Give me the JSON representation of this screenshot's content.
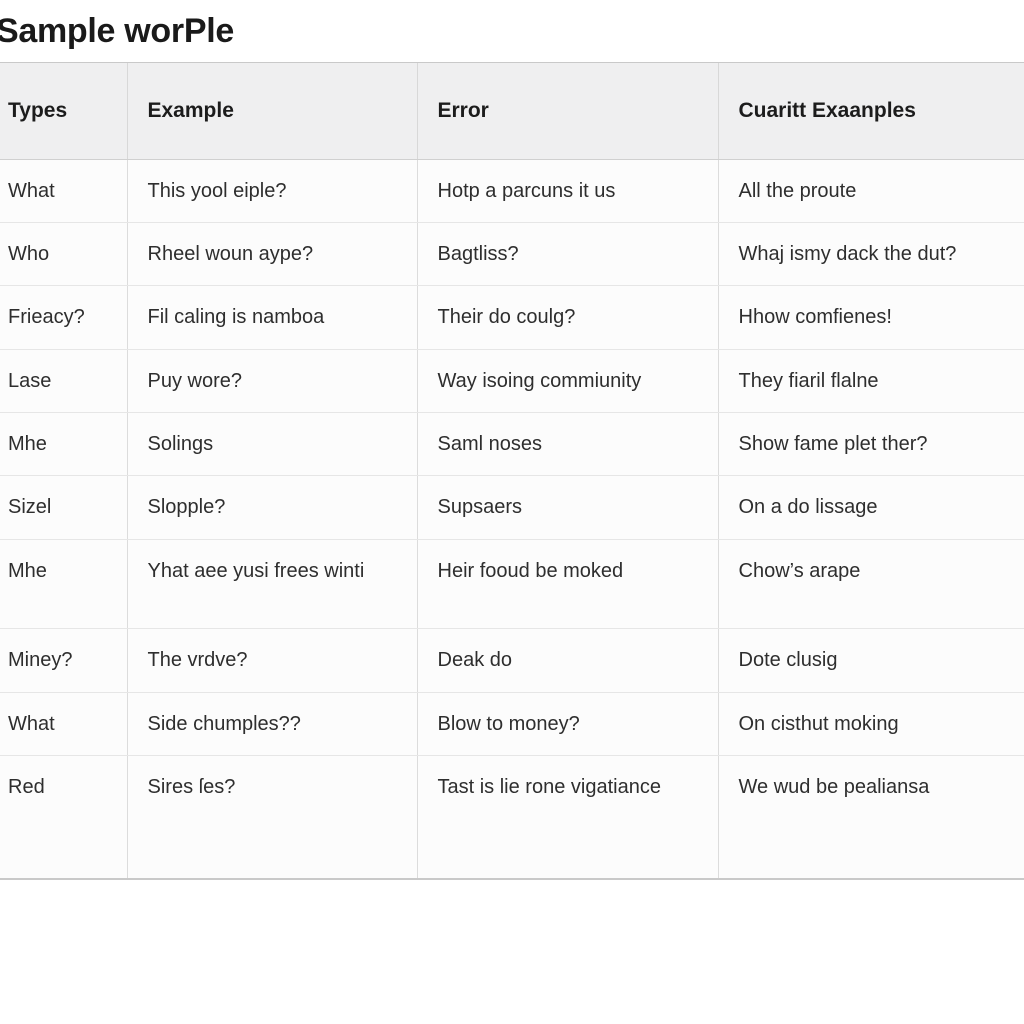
{
  "page": {
    "title": "Sample worPle",
    "background_color": "#ffffff",
    "text_color": "#2e2e2e",
    "header_background_color": "#efeff0",
    "cell_background_color": "#fcfcfc",
    "border_color": "#dcdcdc"
  },
  "table": {
    "columns": [
      {
        "key": "type",
        "label": "Types"
      },
      {
        "key": "example",
        "label": "Example"
      },
      {
        "key": "error",
        "label": "Error"
      },
      {
        "key": "current",
        "label": "Cuaritt Exaanples"
      }
    ],
    "rows": [
      {
        "type": "What",
        "example": "This yool eiple?",
        "error": "Hotp a parcuns it us",
        "current": "All the proute"
      },
      {
        "type": "Who",
        "example": "Rheel woun aype?",
        "error": "Bagtliss?",
        "current": "Whaj ismy dack the dut?"
      },
      {
        "type": "Frieacy?",
        "example": "Fil caling is namboa",
        "error": "Their do coulg?",
        "current": "Hhow comfienes!"
      },
      {
        "type": "Lase",
        "example": "Puy wore?",
        "error": "Way isoing commiunity",
        "current": "They fiaril flalne"
      },
      {
        "type": "Mhe",
        "example": "Solings",
        "error": "Saml noses",
        "current": "Show fame plet ther?"
      },
      {
        "type": "Sizel",
        "example": "Slopple?",
        "error": "Supsaers",
        "current": "On a do lissage"
      },
      {
        "type": "Mhe",
        "example": "Yhat aee yusi frees winti",
        "error": "Heir fooud be moked",
        "current": "Chow’s arape"
      },
      {
        "type": "Miney?",
        "example": "The vrdve?",
        "error": "Deak do",
        "current": "Dote clusig"
      },
      {
        "type": "What",
        "example": "Side chumples??",
        "error": "Blow to money?",
        "current": "On cisthut moking"
      },
      {
        "type": "Red",
        "example": "Sires ſes?",
        "error": "Tast is lie rone vigatiance",
        "current": "We wud be pealiansa"
      }
    ]
  }
}
